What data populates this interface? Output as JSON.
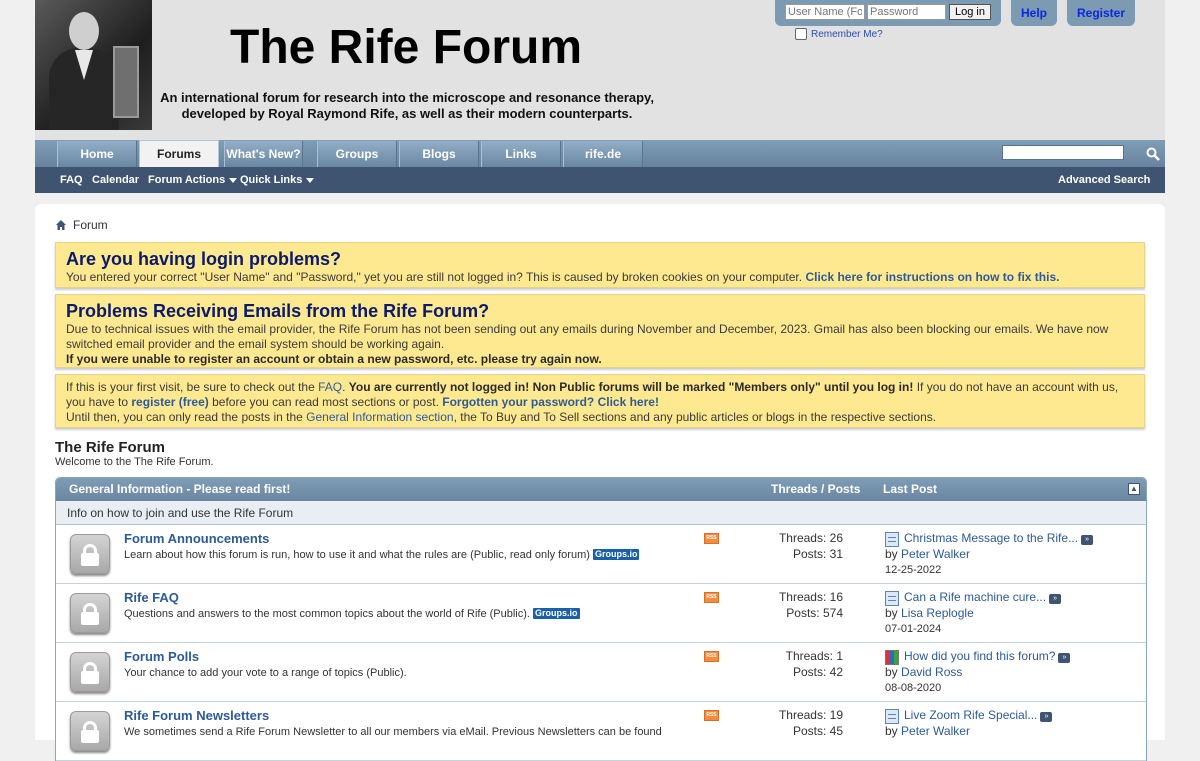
{
  "header": {
    "site_title": "The Rife Forum",
    "tagline_line1": "An international forum for research into the microscope and resonance therapy,",
    "tagline_line2": "developed by Royal Raymond Rife, as well as their modern counterparts.",
    "login": {
      "username_placeholder": "User Name (For",
      "password_placeholder": "Password",
      "login_label": "Log in",
      "remember_label": "Remember Me?"
    },
    "help_label": "Help",
    "register_label": "Register"
  },
  "navbar": {
    "tabs": [
      {
        "label": "Home"
      },
      {
        "label": "Forums"
      },
      {
        "label": "What's New?"
      },
      {
        "label": "Groups"
      },
      {
        "label": "Blogs"
      },
      {
        "label": "Links"
      },
      {
        "label": "rife.de"
      }
    ],
    "active_tab": "Forums",
    "subnav": {
      "faq": "FAQ",
      "calendar": "Calendar",
      "forum_actions": "Forum Actions",
      "quick_links": "Quick Links",
      "advanced_search": "Advanced Search"
    }
  },
  "breadcrumb": {
    "label": "Forum"
  },
  "notices": {
    "login": {
      "title": "Are you having login problems?",
      "text": "You entered your correct \"User Name\" and \"Password,\" yet you are still not logged in? This is caused by broken cookies on your computer.",
      "link": "Click here for instructions on how to fix this."
    },
    "email": {
      "title": "Problems Receiving Emails from the Rife Forum?",
      "text": "Due to technical issues with the email provider, the Rife Forum has not been sending out any emails during November and December, 2023. Gmail has also been blocking our emails. We have now switched email provider and the email system should be working again.",
      "bold": "If you were unable to register an account or obtain a new password, etc. please try again now."
    },
    "visit": {
      "t1": "If this is your first visit, be sure to check out the",
      "faq": "FAQ",
      "bold1": "You are currently not logged in! Non Public forums will be marked \"Members only\" until you log in!",
      "t2": "If you do not have an account with us, you have to",
      "register": "register (free)",
      "t3": "before you can read most sections or post.",
      "forgot": "Forgotten your password? Click here!",
      "t4": "Until then, you can only read the posts in the",
      "general": "General Information section",
      "t5": ", the To Buy and To Sell sections and any public articles or blogs in the respective sections."
    }
  },
  "forum": {
    "title": "The Rife Forum",
    "welcome": "Welcome to the The Rife Forum.",
    "category": {
      "title": "General Information - Please read first!",
      "col_threads_posts": "Threads / Posts",
      "col_last_post": "Last Post",
      "collapse_icon": "collapse-icon",
      "description": "Info on how to join and use the Rife Forum"
    },
    "rows": [
      {
        "title": "Forum Announcements",
        "desc": "Learn about how this forum is run, how to use it and what the rules are (Public, read only forum)",
        "badge": "Groups.io",
        "threads": "Threads: 26",
        "posts": "Posts: 31",
        "last_title": "Christmas Message to the Rife...",
        "last_by": "by",
        "last_user": "Peter Walker",
        "last_date": "12-25-2022",
        "icon": "thread-icon"
      },
      {
        "title": "Rife FAQ",
        "desc": "Questions and answers to the most common topics about the world of Rife (Public).",
        "badge": "Groups.io",
        "threads": "Threads: 16",
        "posts": "Posts: 574",
        "last_title": "Can a Rife machine cure...",
        "last_by": "by",
        "last_user": "Lisa Replogle",
        "last_date": "07-01-2024",
        "icon": "thread-icon"
      },
      {
        "title": "Forum Polls",
        "desc": "Your chance to add your vote to a range of topics (Public).",
        "badge": "",
        "threads": "Threads: 1",
        "posts": "Posts: 42",
        "last_title": "How did you find this forum?",
        "last_by": "by",
        "last_user": "David Ross",
        "last_date": "08-08-2020",
        "icon": "poll-icon"
      },
      {
        "title": "Rife Forum Newsletters",
        "desc": "We sometimes send a Rife Forum Newsletter to all our members via eMail. Previous Newsletters can be found",
        "badge": "",
        "threads": "Threads: 19",
        "posts": "Posts: 45",
        "last_title": "Live Zoom Rife Special...",
        "last_by": "by",
        "last_user": "Peter Walker",
        "last_date": "",
        "icon": "thread-icon"
      }
    ]
  }
}
